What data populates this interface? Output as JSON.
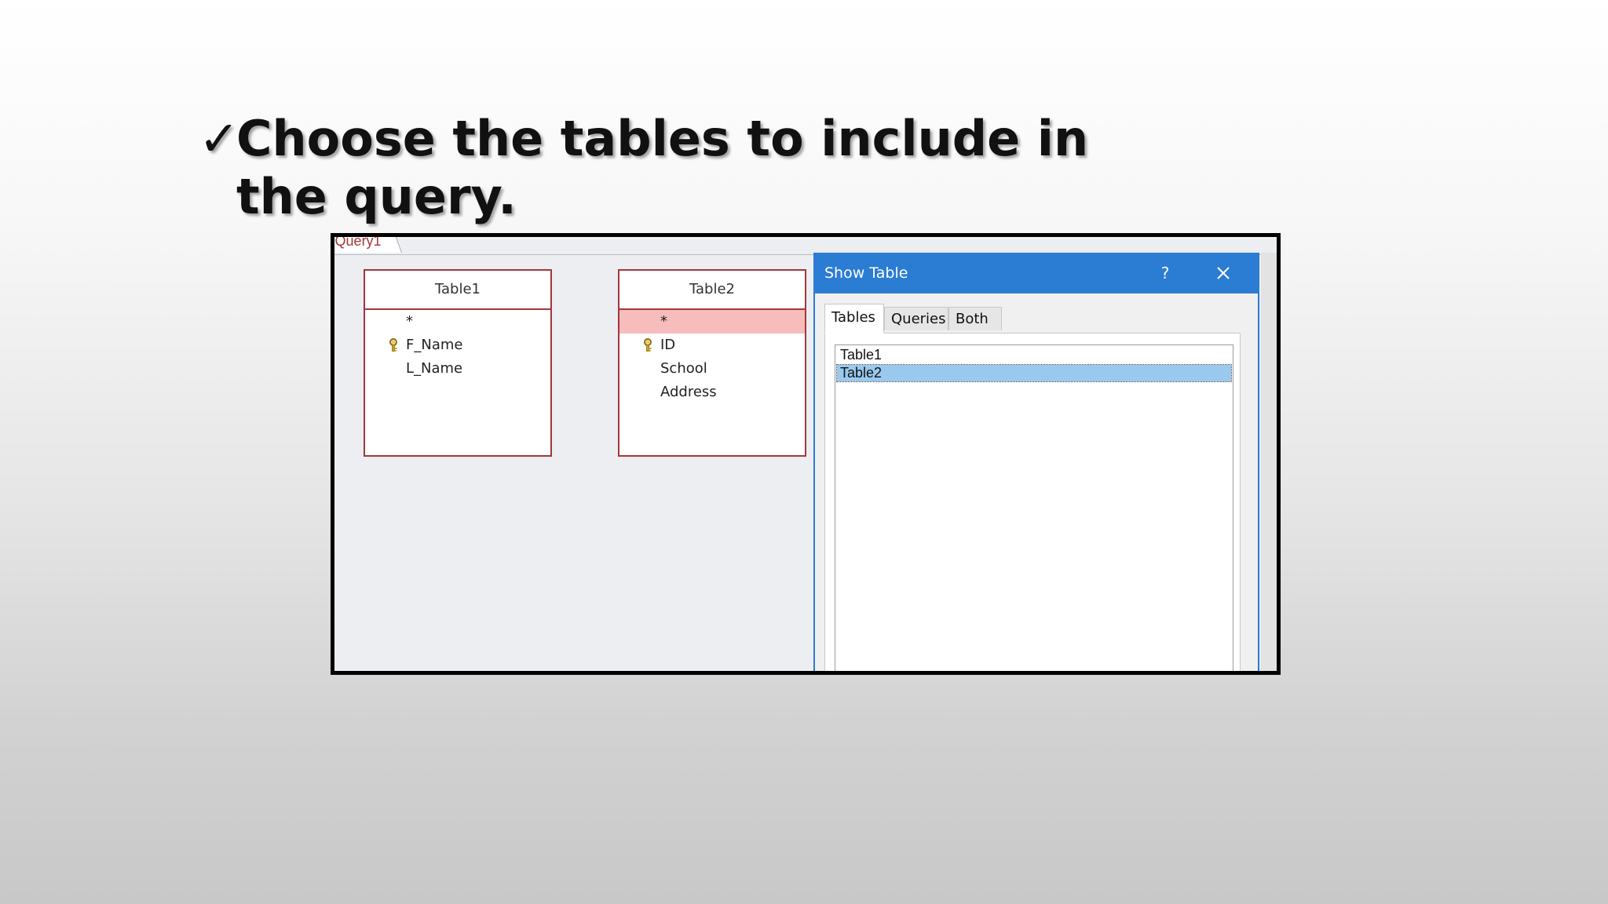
{
  "slide": {
    "check_glyph": "✓",
    "title": "Choose the tables to include in the query."
  },
  "query_window": {
    "tab_label": "Query1",
    "field_lists": [
      {
        "title": "Table1",
        "fields": [
          {
            "label": "*",
            "key": false,
            "selected": false
          },
          {
            "label": "F_Name",
            "key": true,
            "selected": false
          },
          {
            "label": "L_Name",
            "key": false,
            "selected": false
          }
        ]
      },
      {
        "title": "Table2",
        "fields": [
          {
            "label": "*",
            "key": false,
            "selected": true
          },
          {
            "label": "ID",
            "key": true,
            "selected": false
          },
          {
            "label": "School",
            "key": false,
            "selected": false
          },
          {
            "label": "Address",
            "key": false,
            "selected": false
          }
        ]
      }
    ]
  },
  "show_table_dialog": {
    "title": "Show Table",
    "help_label": "?",
    "close_icon": "close-icon",
    "tabs": [
      {
        "label": "Tables",
        "active": true
      },
      {
        "label": "Queries",
        "active": false
      },
      {
        "label": "Both",
        "active": false
      }
    ],
    "items": [
      {
        "label": "Table1",
        "selected": false
      },
      {
        "label": "Table2",
        "selected": true
      }
    ]
  },
  "colors": {
    "titlebar": "#2b7cd3",
    "field_list_border": "#a4373a",
    "field_selected": "#f7bcbc",
    "list_selected": "#99c9ef"
  }
}
